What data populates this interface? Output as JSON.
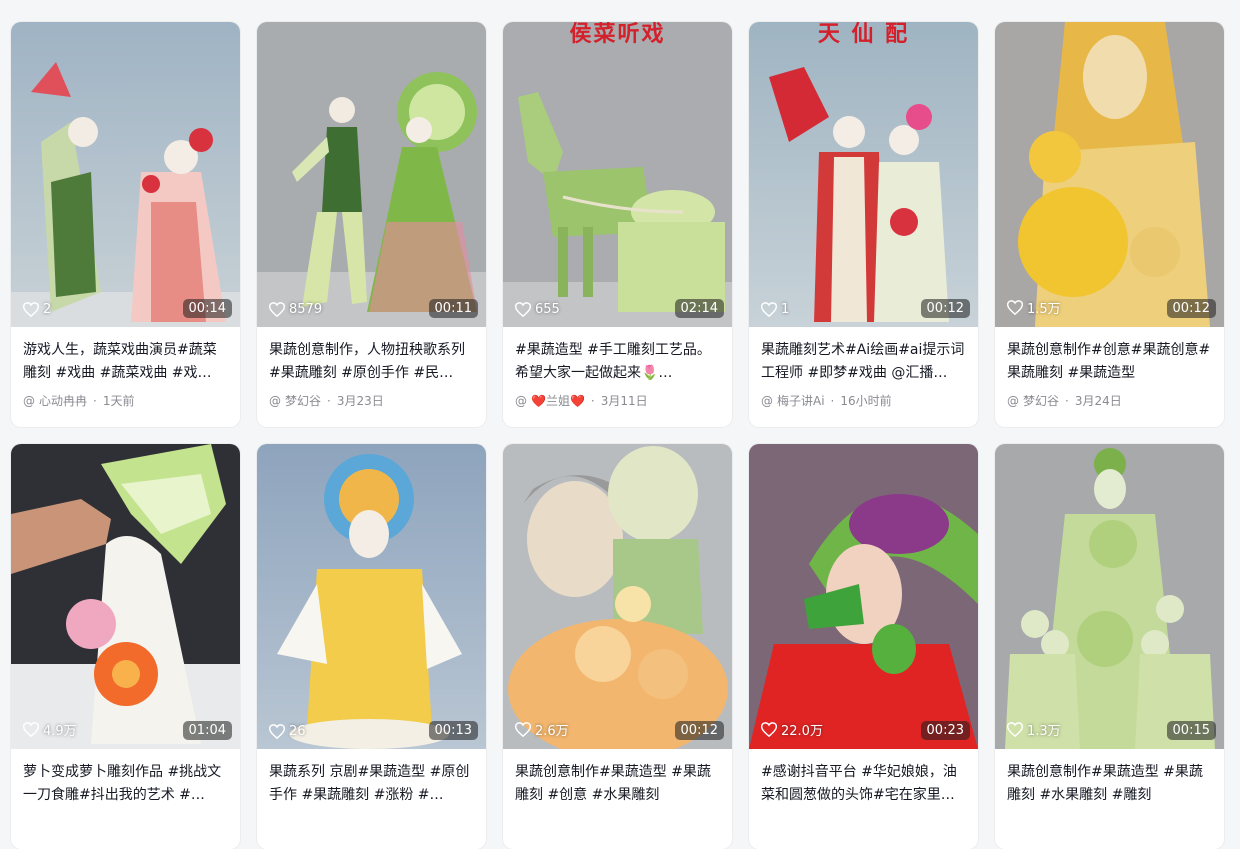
{
  "cards": [
    {
      "title": "游戏人生，蔬菜戏曲演员#蔬菜雕刻 #戏曲 #蔬菜戏曲 #戏…",
      "likes": "2",
      "duration": "00:14",
      "author": "心动冉冉",
      "time": "1天前",
      "overlay": ""
    },
    {
      "title": "果蔬创意制作，人物扭秧歌系列#果蔬雕刻 #原创手作 #民…",
      "likes": "8579",
      "duration": "00:11",
      "author": "梦幻谷",
      "time": "3月23日",
      "overlay": ""
    },
    {
      "title": "#果蔬造型 #手工雕刻工艺品。希望大家一起做起来🌷…",
      "likes": "655",
      "duration": "02:14",
      "author": "❤️兰姐❤️",
      "time": "3月11日",
      "overlay": "侯菜听戏"
    },
    {
      "title": "果蔬雕刻艺术#Ai绘画#ai提示词工程师 #即梦#戏曲 @汇播…",
      "likes": "1",
      "duration": "00:12",
      "author": "梅子讲Ai",
      "time": "16小时前",
      "overlay": "天 仙 配"
    },
    {
      "title": "果蔬创意制作#创意#果蔬创意#果蔬雕刻 #果蔬造型",
      "likes": "1.5万",
      "duration": "00:12",
      "author": "梦幻谷",
      "time": "3月24日",
      "overlay": ""
    },
    {
      "title": "萝卜变成萝卜雕刻作品 #挑战文一刀食雕#抖出我的艺术 #…",
      "likes": "4.9万",
      "duration": "01:04",
      "author": "",
      "time": "",
      "overlay": ""
    },
    {
      "title": "果蔬系列 京剧#果蔬造型 #原创手作 #果蔬雕刻 #涨粉 #…",
      "likes": "26",
      "duration": "00:13",
      "author": "",
      "time": "",
      "overlay": ""
    },
    {
      "title": "果蔬创意制作#果蔬造型 #果蔬雕刻 #创意 #水果雕刻",
      "likes": "2.6万",
      "duration": "00:12",
      "author": "",
      "time": "",
      "overlay": ""
    },
    {
      "title": "#感谢抖音平台 #华妃娘娘，油菜和圆葱做的头饰#宅在家里…",
      "likes": "22.0万",
      "duration": "00:23",
      "author": "",
      "time": "",
      "overlay": ""
    },
    {
      "title": "果蔬创意制作#果蔬造型 #果蔬雕刻 #水果雕刻 #雕刻",
      "likes": "1.3万",
      "duration": "00:15",
      "author": "",
      "time": "",
      "overlay": ""
    }
  ],
  "colors": {
    "accent_red": "#d4202a",
    "meta_gray": "#8a8b91"
  }
}
